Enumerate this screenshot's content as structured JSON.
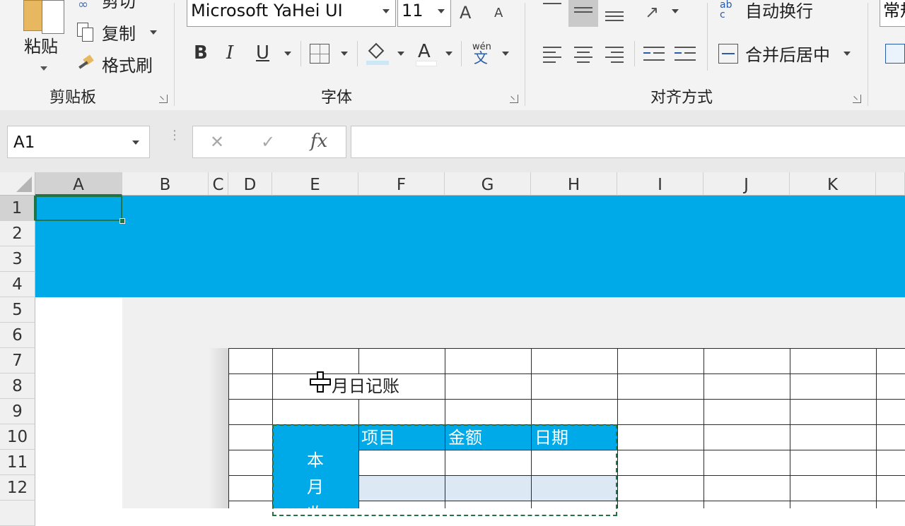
{
  "ribbon": {
    "clipboard": {
      "paste_label": "粘贴",
      "cut_label": "剪切",
      "copy_label": "复制",
      "format_painter_label": "格式刷",
      "group_label": "剪贴板"
    },
    "font": {
      "font_name": "Microsoft YaHei UI",
      "font_size": "11",
      "bold": "B",
      "italic": "I",
      "underline": "U",
      "font_color_glyph": "A",
      "phonetic_glyph": "wén",
      "phonetic_char": "文",
      "grow_font": "A",
      "shrink_font": "A",
      "group_label": "字体"
    },
    "alignment": {
      "wrap_text_label": "自动换行",
      "merge_center_label": "合并后居中",
      "group_label": "对齐方式"
    },
    "number": {
      "format_value": "常规"
    },
    "accent_colors": {
      "fill_highlight": "#cce8f6",
      "font_color_bar": "#ffffff"
    }
  },
  "formula_bar": {
    "name_box": "A1",
    "cancel_glyph": "✕",
    "enter_glyph": "✓",
    "fx_label": "fx",
    "formula_value": ""
  },
  "sheet": {
    "columns": [
      "A",
      "B",
      "C",
      "D",
      "E",
      "F",
      "G",
      "H",
      "I",
      "J",
      "K"
    ],
    "rows": [
      "1",
      "2",
      "3",
      "4",
      "5",
      "6",
      "7",
      "8",
      "9",
      "10",
      "11",
      "12"
    ],
    "banner_color": "#00a9e8",
    "header_fill": "#00a9e8",
    "alt_row_fill": "#dce9f5",
    "title_text": "月日记账",
    "headers": [
      "项目",
      "金额",
      "日期"
    ],
    "side_label_chars": [
      "本",
      "月",
      "收"
    ]
  }
}
